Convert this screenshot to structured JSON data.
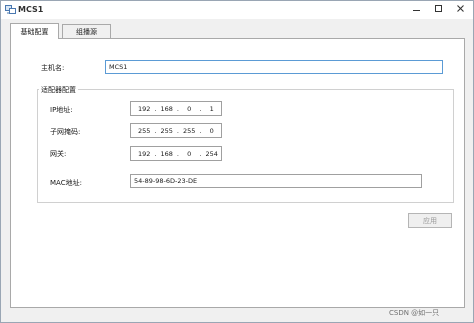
{
  "window": {
    "title": "MCS1"
  },
  "tabs": [
    {
      "label": "基础配置",
      "active": true
    },
    {
      "label": "组播源",
      "active": false
    }
  ],
  "form": {
    "hostname_label": "主机名:",
    "hostname_value": "MCS1",
    "adapter_group_label": "适配器配置",
    "ip_label": "IP地址:",
    "ip_octets": [
      "192",
      "168",
      "0",
      "1"
    ],
    "mask_label": "子网掩码:",
    "mask_octets": [
      "255",
      "255",
      "255",
      "0"
    ],
    "gateway_label": "网关:",
    "gateway_octets": [
      "192",
      "168",
      "0",
      "254"
    ],
    "mac_label": "MAC地址:",
    "mac_value": "54-89-98-6D-23-DE"
  },
  "buttons": {
    "apply_label": "应用",
    "apply_enabled": false
  },
  "watermark": "CSDN @如一只",
  "icons": {
    "app": "app-icon",
    "minimize": "minimize-icon",
    "maximize": "maximize-icon",
    "close": "close-icon"
  },
  "colors": {
    "focus_border": "#5b9bd5",
    "disabled_text": "#9a9a9a"
  }
}
